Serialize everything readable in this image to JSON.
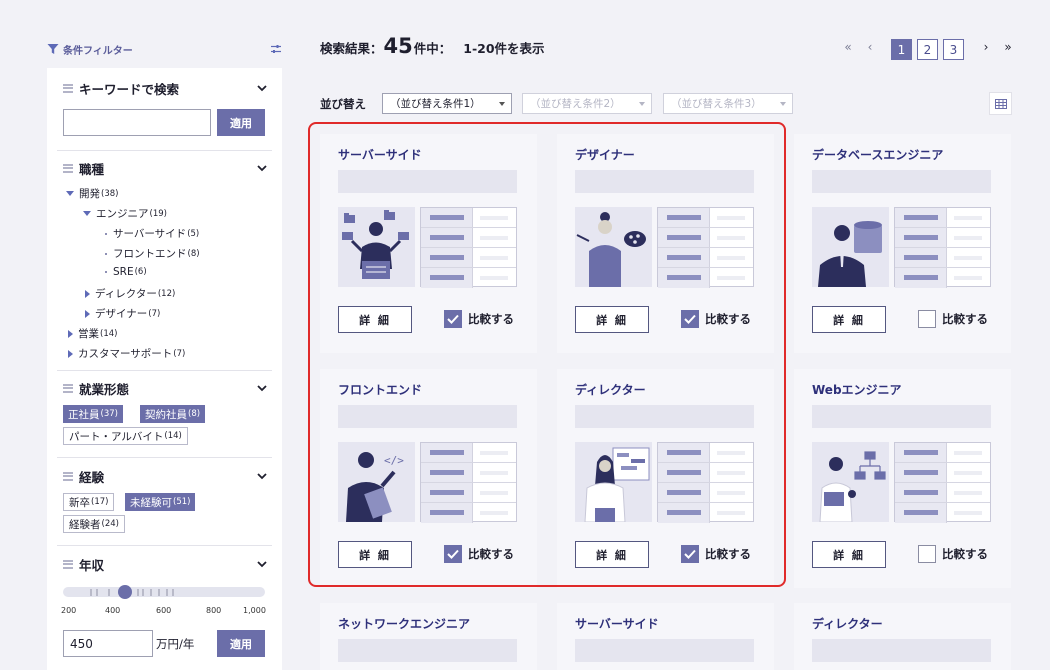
{
  "sidebar": {
    "header_title": "条件フィルター",
    "keyword": {
      "title": "キーワードで検索",
      "input_value": "",
      "apply_label": "適用"
    },
    "job_type": {
      "title": "職種",
      "tree": [
        {
          "label": "開発",
          "count": "(38)"
        },
        {
          "label": "エンジニア",
          "count": "(19)"
        },
        {
          "label": "サーバーサイド",
          "count": "(5)"
        },
        {
          "label": "フロントエンド",
          "count": "(8)"
        },
        {
          "label": "SRE",
          "count": "(6)"
        },
        {
          "label": "ディレクター",
          "count": "(12)"
        },
        {
          "label": "デザイナー",
          "count": "(7)"
        },
        {
          "label": "営業",
          "count": "(14)"
        },
        {
          "label": "カスタマーサポート",
          "count": "(7)"
        }
      ]
    },
    "employment": {
      "title": "就業形態",
      "tags": [
        {
          "label": "正社員",
          "count": "(37)",
          "selected": true
        },
        {
          "label": "契約社員",
          "count": "(8)",
          "selected": true
        },
        {
          "label": "パート・アルバイト",
          "count": "(14)",
          "selected": false
        }
      ]
    },
    "experience": {
      "title": "経験",
      "tags": [
        {
          "label": "新卒",
          "count": "(17)",
          "selected": false
        },
        {
          "label": "未経験可",
          "count": "(51)",
          "selected": true
        },
        {
          "label": "経験者",
          "count": "(24)",
          "selected": false
        }
      ]
    },
    "income": {
      "title": "年収",
      "scale": [
        "200",
        "400",
        "600",
        "800",
        "1,000"
      ],
      "slider_value": 450,
      "input_value": "450",
      "unit": "万円/年",
      "apply_label": "適用"
    }
  },
  "results": {
    "prefix": "検索結果：",
    "total": "45",
    "suffix": "件中：",
    "range": "1-20件を表示"
  },
  "pagination": {
    "first": "«",
    "prev": "‹",
    "next": "›",
    "last": "»",
    "pages": [
      "1",
      "2",
      "3"
    ],
    "current": "1"
  },
  "sort": {
    "label": "並び替え",
    "selects": [
      "（並び替え条件1）",
      "（並び替え条件2）",
      "（並び替え条件3）"
    ]
  },
  "cards": [
    {
      "title": "サーバーサイド",
      "detail_label": "詳 細",
      "compare_label": "比較する",
      "compared": true
    },
    {
      "title": "デザイナー",
      "detail_label": "詳 細",
      "compare_label": "比較する",
      "compared": true
    },
    {
      "title": "データベースエンジニア",
      "detail_label": "詳 細",
      "compare_label": "比較する",
      "compared": false
    },
    {
      "title": "フロントエンド",
      "detail_label": "詳 細",
      "compare_label": "比較する",
      "compared": true
    },
    {
      "title": "ディレクター",
      "detail_label": "詳 細",
      "compare_label": "比較する",
      "compared": true
    },
    {
      "title": "Webエンジニア",
      "detail_label": "詳 細",
      "compare_label": "比較する",
      "compared": false
    },
    {
      "title": "ネットワークエンジニア"
    },
    {
      "title": "サーバーサイド"
    },
    {
      "title": "ディレクター"
    }
  ],
  "colors": {
    "accent": "#6b6ea9",
    "title": "#2e307a",
    "highlight": "#e02a2a"
  }
}
